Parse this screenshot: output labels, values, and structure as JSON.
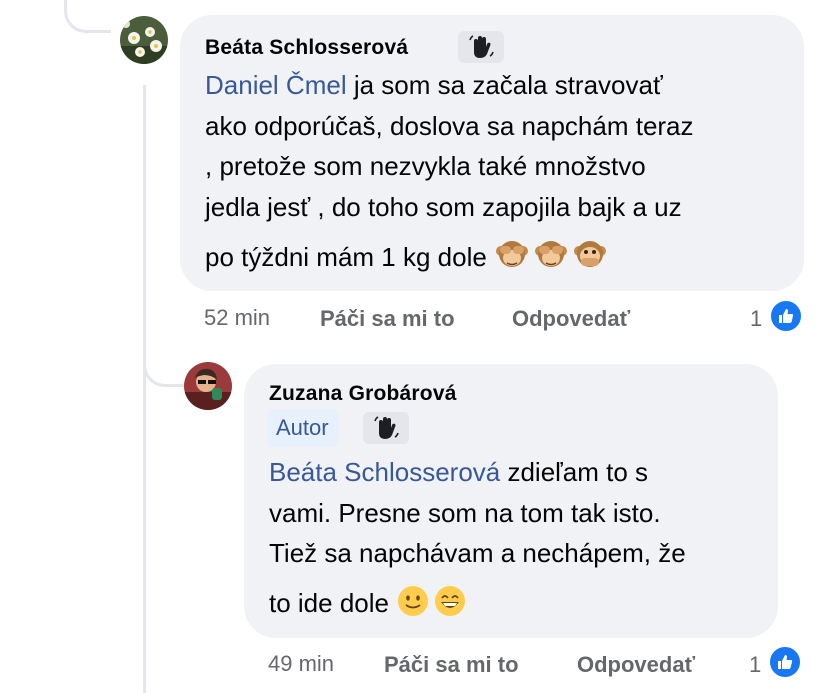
{
  "comments": [
    {
      "author": "Beáta Schlosserová",
      "badge_icon": "wave-hand-icon",
      "mention": "Daniel Čmel",
      "lines": [
        " ja som sa začala stravovať",
        "ako odporúčaš, doslova sa napchám teraz",
        ", pretože som nezvykla  také množstvo",
        "jedla jesť , do toho som zapojila bajk a uz",
        "po týždni mám 1 kg dole "
      ],
      "emojis": [
        "see-no-evil-monkey",
        "see-no-evil-monkey",
        "speak-no-evil-monkey"
      ],
      "time": "52 min",
      "like_label": "Páči sa mi to",
      "reply_label": "Odpovedať",
      "reaction_count": "1"
    },
    {
      "author": "Zuzana Grobárová",
      "author_badge": "Autor",
      "badge_icon": "wave-hand-icon",
      "mention": "Beáta Schlosserová",
      "lines": [
        " zdieľam to s",
        "vami. Presne som na tom tak isto.",
        "Tiež sa napchávam a nechápem, že",
        "to ide dole "
      ],
      "emojis": [
        "slightly-smiling-face",
        "grinning-face-with-smiling-eyes"
      ],
      "time": "49 min",
      "like_label": "Páči sa mi to",
      "reply_label": "Odpovedať",
      "reaction_count": "1"
    }
  ],
  "colors": {
    "bubble": "#f0f2f5",
    "mention": "#385898",
    "meta": "#65676b",
    "like": "#1877f2",
    "author_badge_bg": "#e7f0fd"
  }
}
